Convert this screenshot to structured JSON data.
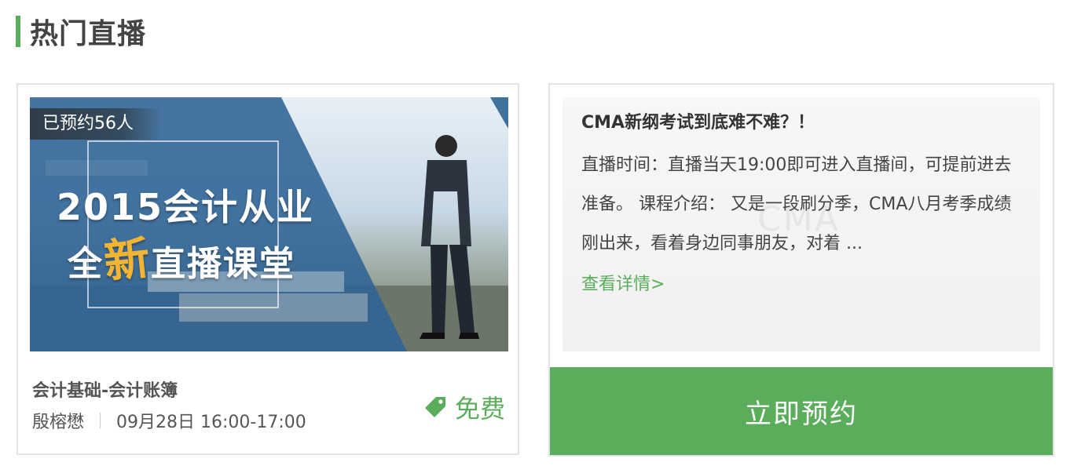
{
  "section": {
    "title": "热门直播"
  },
  "course_card": {
    "booked_label": "已预约56人",
    "banner_line1": "2015会计从业",
    "banner_line2_pre": "全",
    "banner_line2_accent": "新",
    "banner_line2_post": "直播课堂",
    "name": "会计基础-会计账簿",
    "teacher": "殷榕懋",
    "schedule": "09月28日 16:00-17:00",
    "price": "免费",
    "price_icon": "tag-icon"
  },
  "detail_card": {
    "title": "CMA新纲考试到底难不难？！",
    "description": "直播时间：直播当天19:00即可进入直播间，可提前进去准备。 课程介绍： 又是一段刷分季，CMA八月考季成绩刚出来，看着身边同事朋友，对着 ...",
    "watermark": "CMA",
    "more_link": "查看详情>",
    "reserve_button": "立即预约"
  },
  "colors": {
    "accent_green": "#5aad5a",
    "title_text": "#444444",
    "border": "#e3e3e3"
  }
}
